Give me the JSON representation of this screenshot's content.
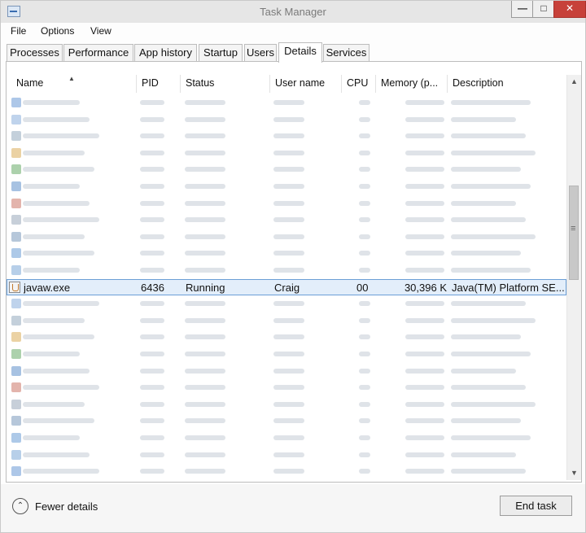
{
  "window": {
    "title": "Task Manager",
    "min_label": "—",
    "max_label": "□",
    "close_label": "✕"
  },
  "menu": [
    "File",
    "Options",
    "View"
  ],
  "tabs": [
    "Processes",
    "Performance",
    "App history",
    "Startup",
    "Users",
    "Details",
    "Services"
  ],
  "active_tab": "Details",
  "columns": [
    "Name",
    "PID",
    "Status",
    "User name",
    "CPU",
    "Memory (p...",
    "Description"
  ],
  "sort_indicator": "▲",
  "selected_process": {
    "name": "javaw.exe",
    "pid": "6436",
    "status": "Running",
    "user": "Craig",
    "cpu": "00",
    "memory": "30,396 K",
    "description": "Java(TM) Platform SE..."
  },
  "blurred_rows_above": 11,
  "blurred_rows_below": 11,
  "footer": {
    "fewer_details_label": "Fewer details",
    "end_task_label": "End task"
  },
  "colors": {
    "selection_bg": "#e3eefa",
    "selection_border": "#6b9fd6",
    "close_button": "#c7413a"
  }
}
